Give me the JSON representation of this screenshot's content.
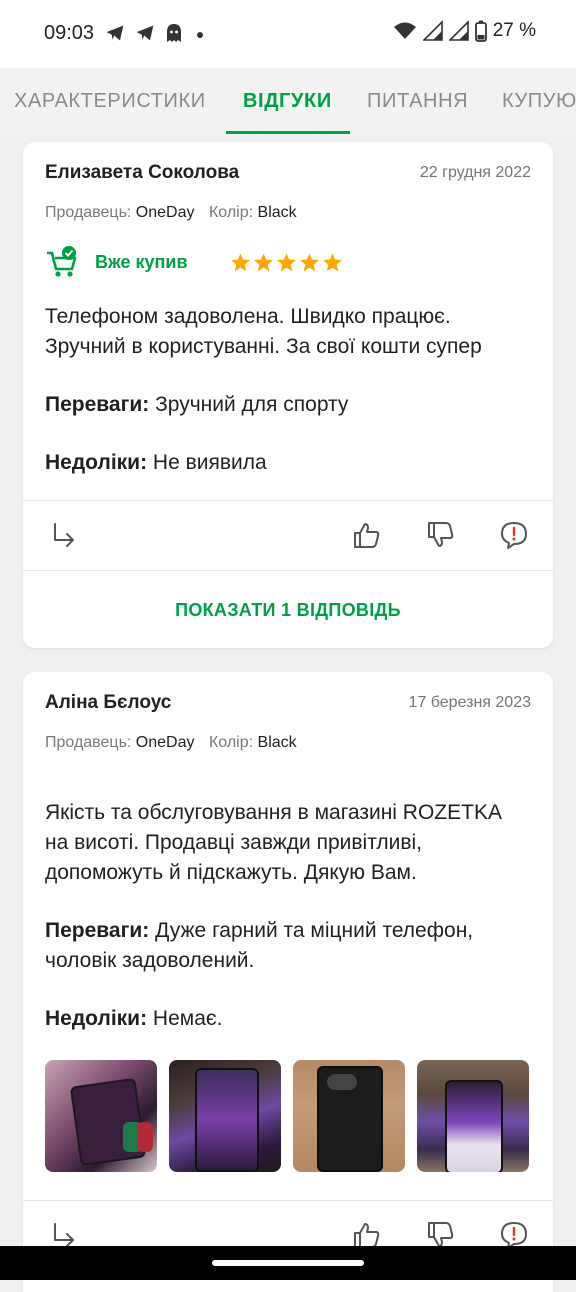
{
  "status_bar": {
    "time": "09:03",
    "battery": "27 %",
    "icons": [
      "telegram-icon",
      "telegram-icon",
      "ghost-icon",
      "dot-icon",
      "wifi-icon",
      "signal-icon",
      "signal-icon",
      "battery-icon"
    ]
  },
  "tabs": [
    {
      "label": "ХАРАКТЕРИСТИКИ",
      "active": false
    },
    {
      "label": "ВІДГУКИ",
      "active": true
    },
    {
      "label": "ПИТАННЯ",
      "active": false
    },
    {
      "label": "КУПУЮ",
      "active": false
    }
  ],
  "colors": {
    "accent": "#00a046",
    "star": "#ffa900",
    "text": "#221f1f",
    "muted": "#797878"
  },
  "reviews": [
    {
      "author": "Елизавета Соколова",
      "date": "22 грудня 2022",
      "seller_label": "Продавець:",
      "seller": "OneDay",
      "color_label": "Колір:",
      "color": "Black",
      "bought_label": "Вже купив",
      "rating": 5,
      "text_line1": "Телефоном задоволена. Швидко працює.",
      "text_line2": "Зручний в користуванні. За свої кошти супер",
      "pros_label": "Переваги:",
      "pros": "Зручний для спорту",
      "cons_label": "Недоліки:",
      "cons": "Не виявила",
      "show_replies": "ПОКАЗАТИ 1 ВІДПОВІДЬ"
    },
    {
      "author": "Аліна Бєлоус",
      "date": "17 березня 2023",
      "seller_label": "Продавець:",
      "seller": "OneDay",
      "color_label": "Колір:",
      "color": "Black",
      "text_line1": "Якість та обслуговування в магазині ROZETKA",
      "text_line2": "на висоті. Продавці завжди привітливі,",
      "text_line3": "допоможуть й підскажуть. Дякую Вам.",
      "pros_label": "Переваги:",
      "pros_line1": "Дуже гарний та міцний телефон,",
      "pros_line2": "чоловік задоволений.",
      "cons_label": "Недоліки:",
      "cons": "Немає.",
      "photo_count": 4
    }
  ]
}
